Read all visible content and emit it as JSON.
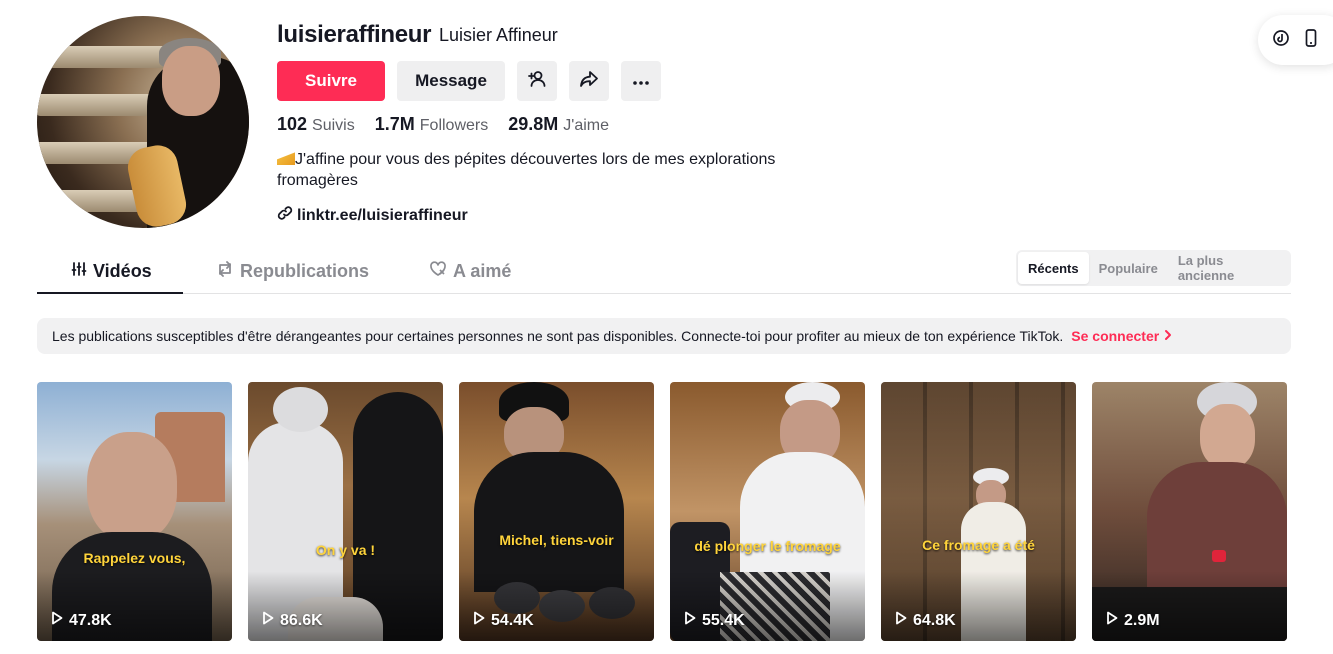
{
  "profile": {
    "username": "luisieraffineur",
    "nickname": "Luisier Affineur",
    "bio_line1": "J'affine pour vous des pépites découvertes lors de mes explorations",
    "bio_line2": "fromagères",
    "link": "linktr.ee/luisieraffineur"
  },
  "actions": {
    "follow": "Suivre",
    "message": "Message"
  },
  "stats": [
    {
      "value": "102",
      "label": "Suivis"
    },
    {
      "value": "1.7M",
      "label": "Followers"
    },
    {
      "value": "29.8M",
      "label": "J'aime"
    }
  ],
  "tabs": {
    "videos": "Vidéos",
    "reposts": "Republications",
    "liked": "A aimé"
  },
  "sort": {
    "recent": "Récents",
    "popular": "Populaire",
    "oldest": "La plus ancienne"
  },
  "notice": {
    "text": "Les publications susceptibles d'être dérangeantes pour certaines personnes ne sont pas disponibles. Connecte-toi pour profiter au mieux de ton expérience TikTok.",
    "cta": "Se connecter"
  },
  "videos": [
    {
      "caption": "Rappelez vous,",
      "views": "47.8K"
    },
    {
      "caption": "On y va !",
      "views": "86.6K"
    },
    {
      "caption": "Michel, tiens-voir",
      "views": "54.4K"
    },
    {
      "caption": "dé plonger le fromage",
      "views": "55.4K"
    },
    {
      "caption": "Ce fromage a été",
      "views": "64.8K"
    },
    {
      "caption": "",
      "views": "2.9M"
    }
  ],
  "colors": {
    "accent": "#fe2c55",
    "caption": "#ffd43b"
  }
}
